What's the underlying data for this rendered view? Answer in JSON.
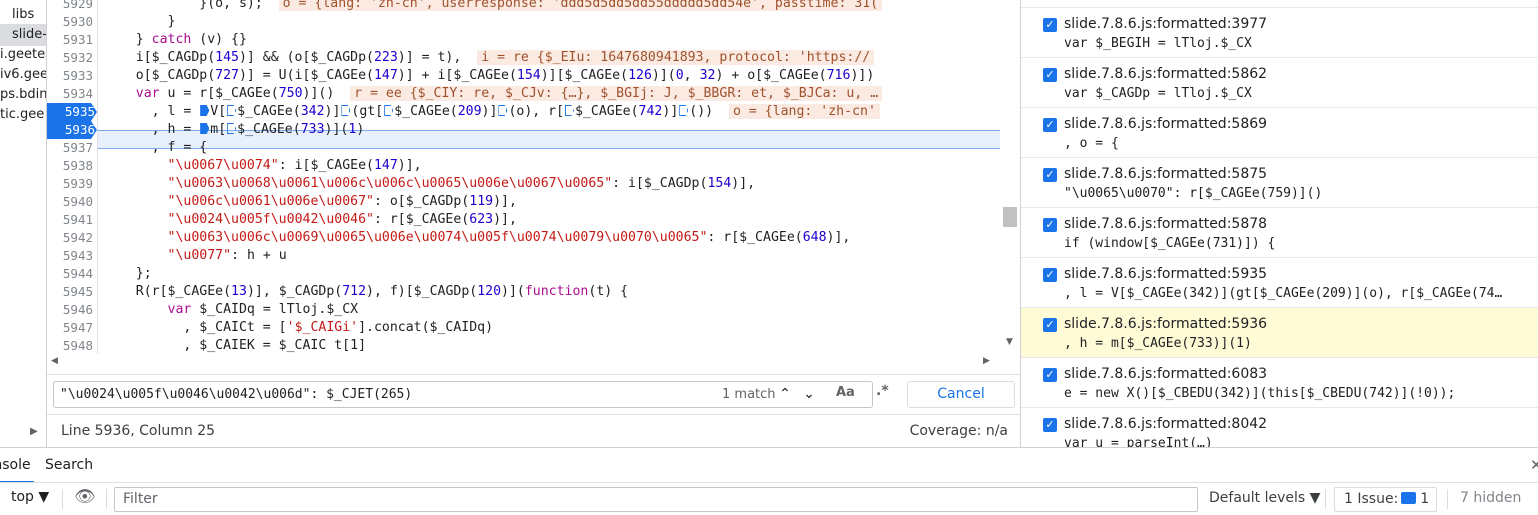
{
  "navigator": {
    "items": [
      "libs",
      "slide-",
      "i.geetes",
      "iv6.gee",
      "ps.bdin",
      "tic.gee"
    ],
    "selected_index": 1
  },
  "editor": {
    "lines": [
      {
        "n": "5929",
        "code": "            }(o, s);",
        "inline": "o = {lang: 'zh-cn', userresponse: 'ddd5d5dd5dd55ddddd5dd54e', passtime: 31("
      },
      {
        "n": "5930",
        "code": "        }",
        "inline": ""
      },
      {
        "n": "5931",
        "code": "    } catch (v) {}",
        "inline": ""
      },
      {
        "n": "5932",
        "code": "    i[$_CAGDp(145)] && (o[$_CAGDp(223)] = t),",
        "inline": "i = re {$_EIu: 1647680941893, protocol: 'https://"
      },
      {
        "n": "5933",
        "code": "    o[$_CAGDp(727)] = U(i[$_CAGEe(147)] + i[$_CAGEe(154)][$_CAGEe(126)](0, 32) + o[$_CAGEe(716)])",
        "inline": ""
      },
      {
        "n": "5934",
        "code": "    var u = r[$_CAGEe(750)]()",
        "inline": "r = ee {$_CIY: re, $_CJv: {…}, $_BGIj: J, $_BBGR: et, $_BJCa: u, …"
      },
      {
        "n": "5935",
        "code": "      , l = V[$_CAGEe(342)](gt[$_CAGEe(209)](o), r[$_CAGEe(742)]())",
        "inline": "o = {lang: 'zh-cn'"
      },
      {
        "n": "5936",
        "code": "      , h = m[$_CAGEe(733)](1)",
        "inline": ""
      },
      {
        "n": "5937",
        "code": "      , f = {",
        "inline": ""
      },
      {
        "n": "5938",
        "code": "        \"\\u0067\\u0074\": i[$_CAGEe(147)],",
        "inline": ""
      },
      {
        "n": "5939",
        "code": "        \"\\u0063\\u0068\\u0061\\u006c\\u006c\\u0065\\u006e\\u0067\\u0065\": i[$_CAGDp(154)],",
        "inline": ""
      },
      {
        "n": "5940",
        "code": "        \"\\u006c\\u0061\\u006e\\u0067\": o[$_CAGDp(119)],",
        "inline": ""
      },
      {
        "n": "5941",
        "code": "        \"\\u0024\\u005f\\u0042\\u0046\": r[$_CAGEe(623)],",
        "inline": ""
      },
      {
        "n": "5942",
        "code": "        \"\\u0063\\u006c\\u0069\\u0065\\u006e\\u0074\\u005f\\u0074\\u0079\\u0070\\u0065\": r[$_CAGEe(648)],",
        "inline": ""
      },
      {
        "n": "5943",
        "code": "        \"\\u0077\": h + u",
        "inline": ""
      },
      {
        "n": "5944",
        "code": "    };",
        "inline": ""
      },
      {
        "n": "5945",
        "code": "    R(r[$_CAGEe(13)], $_CAGDp(712), f)[$_CAGDp(120)](function(t) {",
        "inline": ""
      },
      {
        "n": "5946",
        "code": "        var $_CAIDq = lTloj.$_CX",
        "inline": ""
      },
      {
        "n": "5947",
        "code": "          , $_CAICt = ['$_CAIGi'].concat($_CAIDq)",
        "inline": ""
      },
      {
        "n": "5948",
        "code": "          , $_CAIEK = $_CAIC t[1]",
        "inline": ""
      }
    ]
  },
  "search": {
    "query": "\"\\u0024\\u005f\\u0046\\u0042\\u006d\": $_CJET(265)",
    "match_count": "1 match",
    "case_label": "Aa",
    "regex_label": ".*",
    "cancel_label": "Cancel"
  },
  "status": {
    "position": "Line 5936, Column 25",
    "coverage": "Coverage: n/a"
  },
  "breakpoints": [
    {
      "file": "slide.7.8.6.js:formatted:3977",
      "code": "var $_BEGIH = lTloj.$_CX",
      "highlight": false
    },
    {
      "file": "slide.7.8.6.js:formatted:5862",
      "code": "var $_CAGDp = lTloj.$_CX",
      "highlight": false
    },
    {
      "file": "slide.7.8.6.js:formatted:5869",
      "code": ", o = {",
      "highlight": false
    },
    {
      "file": "slide.7.8.6.js:formatted:5875",
      "code": "\"\\u0065\\u0070\": r[$_CAGEe(759)]()",
      "highlight": false
    },
    {
      "file": "slide.7.8.6.js:formatted:5878",
      "code": "if (window[$_CAGEe(731)]) {",
      "highlight": false
    },
    {
      "file": "slide.7.8.6.js:formatted:5935",
      "code": ", l = V[$_CAGEe(342)](gt[$_CAGEe(209)](o), r[$_CAGEe(74…",
      "highlight": false
    },
    {
      "file": "slide.7.8.6.js:formatted:5936",
      "code": ", h = m[$_CAGEe(733)](1)",
      "highlight": true
    },
    {
      "file": "slide.7.8.6.js:formatted:6083",
      "code": "e = new X()[$_CBEDU(342)](this[$_CBEDU(742)](!0));",
      "highlight": false
    },
    {
      "file": "slide.7.8.6.js:formatted:8042",
      "code": "var u = parseInt(…)",
      "highlight": false
    }
  ],
  "drawer": {
    "tab_console": "Console",
    "tab_search": "Search",
    "close": "✕"
  },
  "console_bar": {
    "context": "top ▼",
    "filter_placeholder": "Filter",
    "levels": "Default levels ▼",
    "issues_label": "1 Issue:",
    "issues_count": "1",
    "hidden": "7 hidden"
  },
  "colors": {
    "accent": "#1a73e8",
    "highlight": "#fffbd7",
    "current_line": "#e8f0fe"
  }
}
